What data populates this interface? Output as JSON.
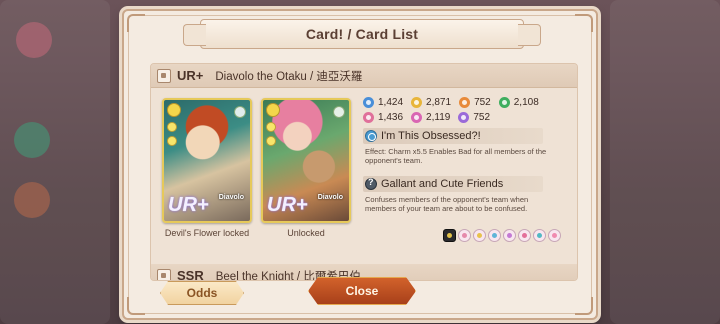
{
  "dialog": {
    "title": "Card! / Card List"
  },
  "entries": [
    {
      "rarity": "UR+",
      "name": "Diavolo the Otaku / 迪亞沃羅",
      "cards": [
        {
          "caption": "Devil's Flower locked",
          "badge": "UR+",
          "character": "Diavolo"
        },
        {
          "caption": "Unlocked",
          "badge": "UR+",
          "character": "Diavolo"
        }
      ],
      "stats": [
        [
          {
            "icon": "snowflake-stat-icon",
            "color": "#4a8fd8",
            "value": "1,424"
          },
          {
            "icon": "sun-stat-icon",
            "color": "#e8b53a",
            "value": "2,871"
          },
          {
            "icon": "flame-stat-icon",
            "color": "#e88a3a",
            "value": "752"
          },
          {
            "icon": "leaf-stat-icon",
            "color": "#3fae5f",
            "value": "2,108"
          }
        ],
        [
          {
            "icon": "diamond-stat-icon",
            "color": "#e0709a",
            "value": "1,436"
          },
          {
            "icon": "heart-stat-icon",
            "color": "#d966b3",
            "value": "2,119"
          },
          {
            "icon": "star-stat-icon",
            "color": "#9a6ad9",
            "value": "752"
          }
        ]
      ],
      "skills": [
        {
          "name": "I'm This Obsessed?!",
          "type": "active",
          "desc": "Effect: Charm x5.5 Enables Bad for all members of the opponent's team."
        },
        {
          "name": "Gallant and Cute Friends",
          "type": "passive",
          "desc": "Confuses members of the opponent's team when members of your team are about to be confused."
        }
      ]
    },
    {
      "rarity": "SSR",
      "name": "Beel the Knight / 比爾希巴伯"
    }
  ],
  "buttons": {
    "odds": "Odds",
    "close": "Close"
  }
}
